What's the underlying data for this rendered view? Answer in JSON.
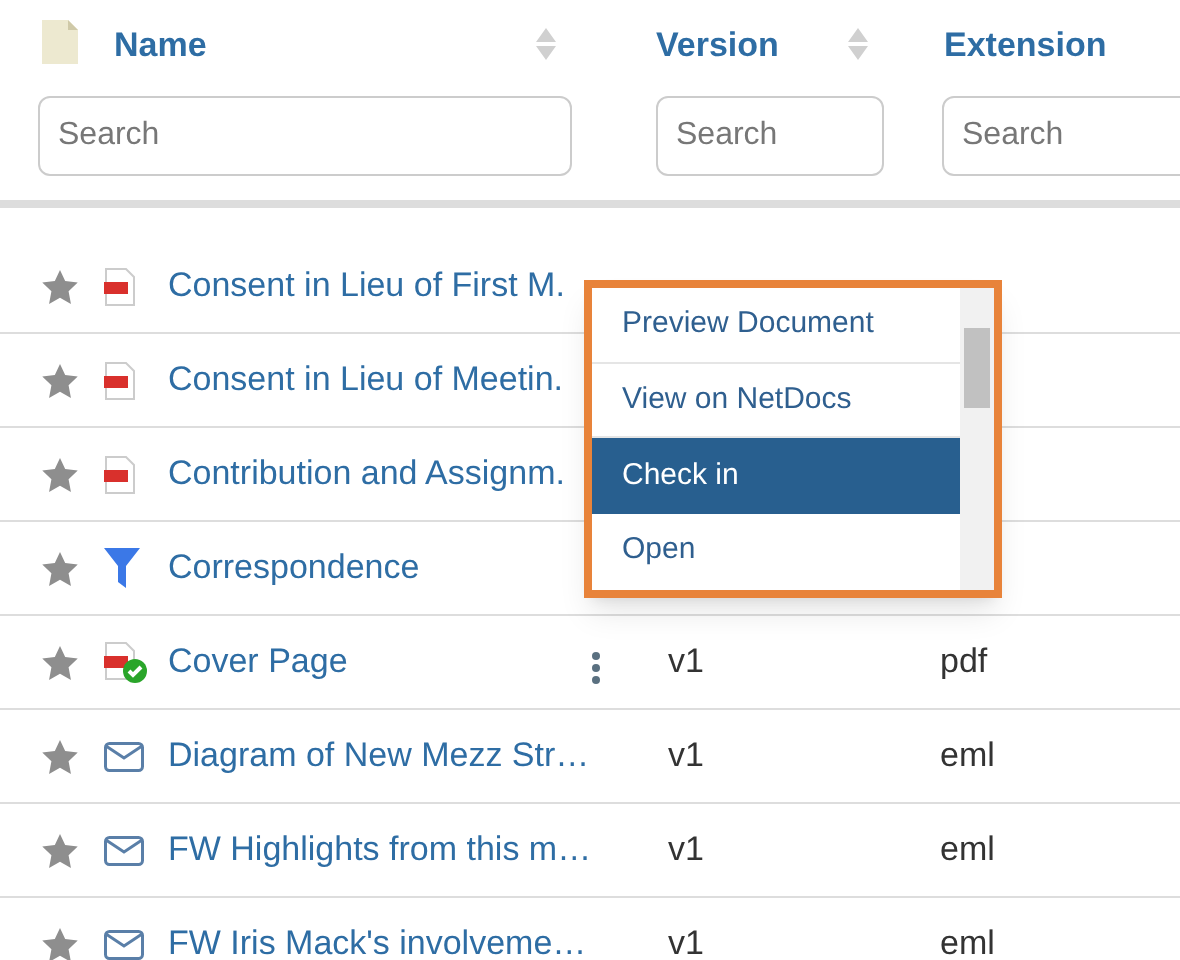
{
  "columns": [
    {
      "label": "Name",
      "sortable": true,
      "placeholder": "Search"
    },
    {
      "label": "Version",
      "sortable": true,
      "placeholder": "Search"
    },
    {
      "label": "Extension",
      "sortable": false,
      "placeholder": "Search"
    }
  ],
  "rows": [
    {
      "kind": "pdf",
      "name": "Consent in Lieu of First M."
    },
    {
      "kind": "pdf",
      "name": "Consent in Lieu of Meetin."
    },
    {
      "kind": "pdf",
      "name": "Contribution and Assignm."
    },
    {
      "kind": "filter",
      "name": "Correspondence"
    },
    {
      "kind": "pdf-checked",
      "name": "Cover Page",
      "actions": true,
      "version": "v1",
      "extension": "pdf"
    },
    {
      "kind": "email",
      "name": "Diagram of New Mezz Str…",
      "version": "v1",
      "extension": "eml"
    },
    {
      "kind": "email",
      "name": "FW Highlights from this m…",
      "version": "v1",
      "extension": "eml"
    },
    {
      "kind": "email",
      "name": "FW Iris Mack's involveme…",
      "version": "v1",
      "extension": "eml"
    }
  ],
  "context_menu": {
    "items": [
      {
        "label": "Preview Document",
        "selected": false
      },
      {
        "label": "View on NetDocs",
        "selected": false
      },
      {
        "label": "Check in",
        "selected": true
      },
      {
        "label": "Open",
        "selected": false
      }
    ]
  }
}
